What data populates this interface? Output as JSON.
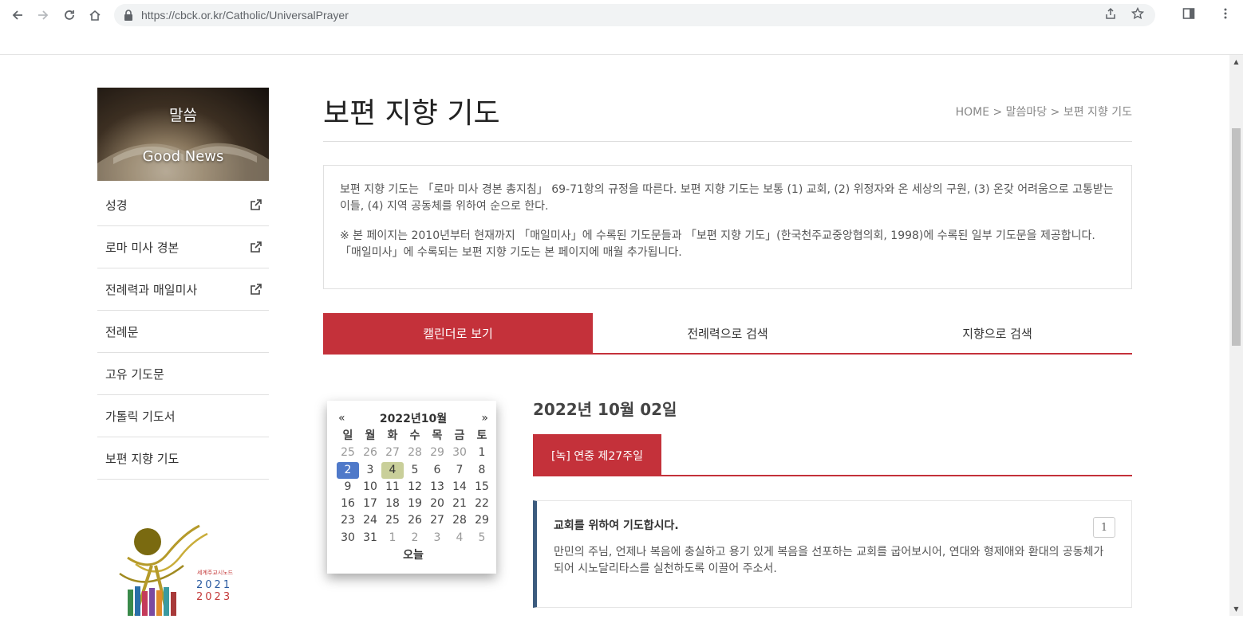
{
  "browser": {
    "url": "https://cbck.or.kr/Catholic/UniversalPrayer",
    "back_icon": "back-arrow-icon",
    "forward_icon": "forward-arrow-icon",
    "reload_icon": "reload-icon",
    "home_icon": "home-icon"
  },
  "sidebar": {
    "banner_title": "말씀",
    "banner_subtitle": "Good News",
    "items": [
      {
        "label": "성경",
        "external": true
      },
      {
        "label": "로마 미사 경본",
        "external": true
      },
      {
        "label": "전례력과 매일미사",
        "external": true
      },
      {
        "label": "전례문",
        "external": false
      },
      {
        "label": "고유 기도문",
        "external": false
      },
      {
        "label": "가톨릭 기도서",
        "external": false
      },
      {
        "label": "보편 지향 기도",
        "external": false
      }
    ],
    "logo": {
      "year1": "2021",
      "year2": "2023",
      "caption": "세계주교시노드"
    }
  },
  "main": {
    "title": "보편 지향 기도",
    "breadcrumb": "HOME > 말씀마당 > 보편 지향 기도",
    "info_p1": "보편 지향 기도는 「로마 미사 경본 총지침」 69-71항의 규정을 따른다. 보편 지향 기도는 보통 (1) 교회, (2) 위정자와 온 세상의 구원, (3) 온갖 어려움으로 고통받는 이들, (4) 지역 공동체를 위하여 순으로 한다.",
    "info_p2": "※ 본 페이지는 2010년부터 현재까지 「매일미사」에 수록된 기도문들과 「보편 지향 기도」(한국천주교중앙협의회, 1998)에 수록된 일부 기도문을 제공합니다. 「매일미사」에 수록되는 보편 지향 기도는 본 페이지에 매월 추가됩니다.",
    "tabs": [
      "캘린더로 보기",
      "전례력으로 검색",
      "지향으로 검색"
    ],
    "active_tab": 0
  },
  "calendar": {
    "prev": "«",
    "next": "»",
    "month_label": "2022년10월",
    "weekdays": [
      "일",
      "월",
      "화",
      "수",
      "목",
      "금",
      "토"
    ],
    "days": [
      [
        "25",
        "26",
        "27",
        "28",
        "29",
        "30",
        "1"
      ],
      [
        "2",
        "3",
        "4",
        "5",
        "6",
        "7",
        "8"
      ],
      [
        "9",
        "10",
        "11",
        "12",
        "13",
        "14",
        "15"
      ],
      [
        "16",
        "17",
        "18",
        "19",
        "20",
        "21",
        "22"
      ],
      [
        "23",
        "24",
        "25",
        "26",
        "27",
        "28",
        "29"
      ],
      [
        "30",
        "31",
        "1",
        "2",
        "3",
        "4",
        "5"
      ]
    ],
    "selected": "2",
    "today": "4",
    "today_label": "오늘"
  },
  "day_view": {
    "date": "2022년 10월 02일",
    "week_label": "[녹] 연중 제27주일",
    "prayer": {
      "title": "교회를 위하여 기도합시다.",
      "text": "만민의 주님, 언제나 복음에 충실하고 용기 있게 복음을 선포하는 교회를 굽어보시어, 연대와 형제애와 환대의 공동체가 되어 시노달리타스를 실천하도록 이끌어 주소서.",
      "number": "1"
    }
  }
}
